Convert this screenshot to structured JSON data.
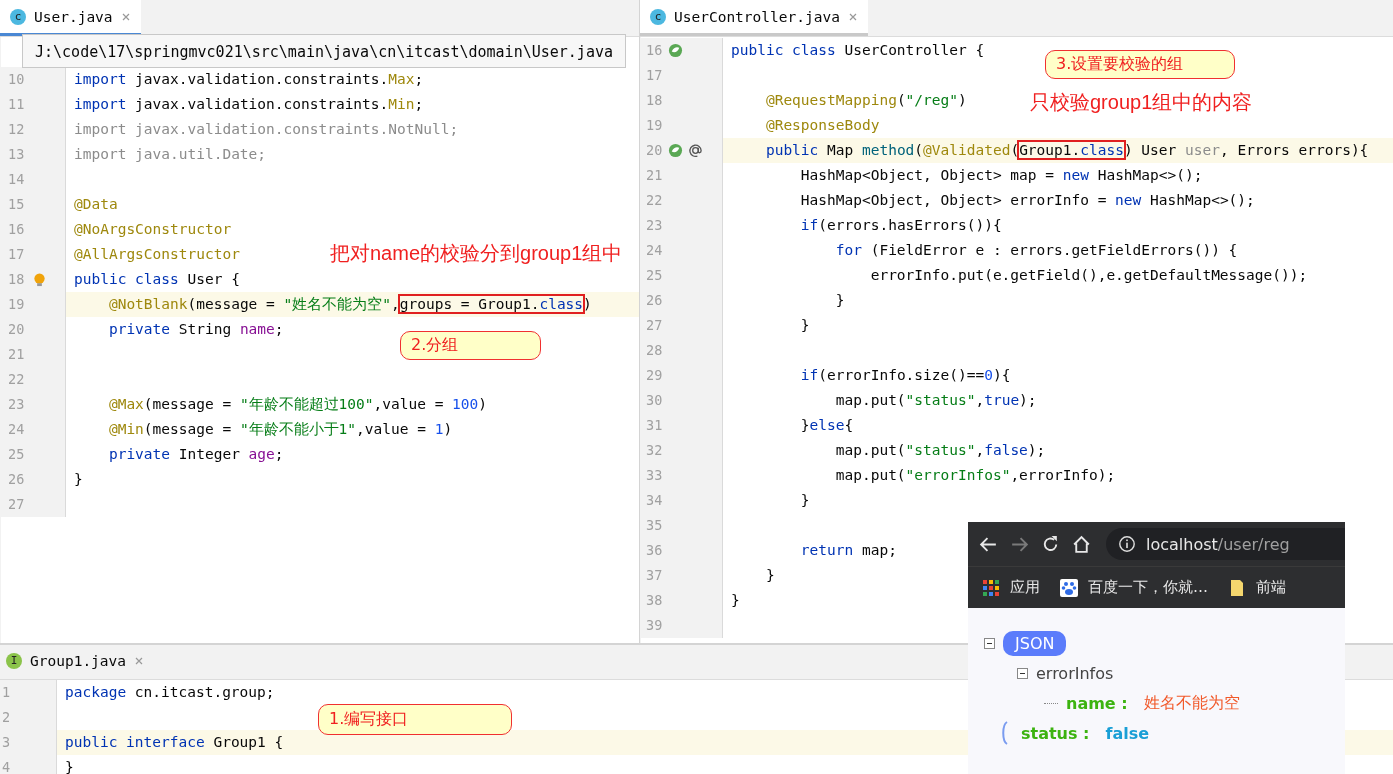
{
  "editors": [
    {
      "tabs": [
        {
          "label": "User.java",
          "badge": "c",
          "kind": "class",
          "selected": true
        }
      ],
      "tooltip": "J:\\code\\17\\springmvc021\\src\\main\\java\\cn\\itcast\\domain\\User.java",
      "lines": [
        {
          "n": "10",
          "current": false,
          "t": [
            {
              "kind": "kw",
              "text": "import"
            },
            {
              "kind": "p",
              "text": " javax.validation.constraints."
            },
            {
              "kind": "ann",
              "text": "Max"
            },
            {
              "kind": "p",
              "text": ";"
            }
          ]
        },
        {
          "n": "11",
          "current": false,
          "t": [
            {
              "kind": "kw",
              "text": "import"
            },
            {
              "kind": "p",
              "text": " javax.validation.constraints."
            },
            {
              "kind": "ann",
              "text": "Min"
            },
            {
              "kind": "p",
              "text": ";"
            }
          ]
        },
        {
          "n": "12",
          "current": false,
          "t": [
            {
              "kind": "dim",
              "text": "import javax.validation.constraints.NotNull;"
            }
          ]
        },
        {
          "n": "13",
          "current": false,
          "t": [
            {
              "kind": "dim",
              "text": "import java.util.Date;"
            }
          ]
        },
        {
          "n": "14",
          "current": false
        },
        {
          "n": "15",
          "current": false,
          "t": [
            {
              "kind": "ann",
              "text": "@Data"
            }
          ]
        },
        {
          "n": "16",
          "current": false,
          "t": [
            {
              "kind": "ann",
              "text": "@NoArgsConstructor"
            }
          ]
        },
        {
          "n": "17",
          "current": false,
          "t": [
            {
              "kind": "ann",
              "text": "@AllArgsConstructor"
            }
          ]
        },
        {
          "n": "18",
          "current": false,
          "gutter": [
            {
              "kind": "bulb"
            }
          ],
          "t": [
            {
              "kind": "kw",
              "text": "public class"
            },
            {
              "kind": "p",
              "text": " User {"
            }
          ]
        },
        {
          "n": "19",
          "current": true,
          "t": [
            {
              "kind": "ann",
              "text": "    @NotBlank"
            },
            {
              "kind": "p",
              "text": "(message = "
            },
            {
              "kind": "str",
              "text": "\"姓名不能为空\""
            },
            {
              "kind": "p",
              "text": ","
            },
            {
              "kind": "box",
              "parts": [
                {
                  "kind": "p",
                  "text": "groups = Group1."
                },
                {
                  "kind": "kw",
                  "text": "class"
                }
              ]
            },
            {
              "kind": "p",
              "text": ")"
            }
          ]
        },
        {
          "n": "20",
          "current": false,
          "t": [
            {
              "kind": "kw",
              "text": "    private"
            },
            {
              "kind": "p",
              "text": " String "
            },
            {
              "kind": "field",
              "text": "name"
            },
            {
              "kind": "p",
              "text": ";"
            }
          ]
        },
        {
          "n": "21",
          "current": false
        },
        {
          "n": "22",
          "current": false
        },
        {
          "n": "23",
          "current": false,
          "t": [
            {
              "kind": "ann",
              "text": "    @Max"
            },
            {
              "kind": "p",
              "text": "(message = "
            },
            {
              "kind": "str",
              "text": "\"年龄不能超过100\""
            },
            {
              "kind": "p",
              "text": ",value = "
            },
            {
              "kind": "num",
              "text": "100"
            },
            {
              "kind": "p",
              "text": ")"
            }
          ]
        },
        {
          "n": "24",
          "current": false,
          "t": [
            {
              "kind": "ann",
              "text": "    @Min"
            },
            {
              "kind": "p",
              "text": "(message = "
            },
            {
              "kind": "str",
              "text": "\"年龄不能小于1\""
            },
            {
              "kind": "p",
              "text": ",value = "
            },
            {
              "kind": "num",
              "text": "1"
            },
            {
              "kind": "p",
              "text": ")"
            }
          ]
        },
        {
          "n": "25",
          "current": false,
          "t": [
            {
              "kind": "kw",
              "text": "    private"
            },
            {
              "kind": "p",
              "text": " Integer "
            },
            {
              "kind": "field",
              "text": "age"
            },
            {
              "kind": "p",
              "text": ";"
            }
          ]
        },
        {
          "n": "26",
          "current": false,
          "t": [
            {
              "kind": "p",
              "text": "}"
            }
          ]
        },
        {
          "n": "27",
          "current": false
        }
      ],
      "notes": [
        {
          "kind": "label",
          "text": "把对name的校验分到group1组中"
        },
        {
          "kind": "bubble",
          "text": "2.分组"
        }
      ]
    },
    {
      "tabs": [
        {
          "label": "UserController.java",
          "badge": "c",
          "kind": "class",
          "selected": false
        }
      ],
      "lines": [
        {
          "n": "16",
          "current": false,
          "gutter": [
            {
              "kind": "bean"
            }
          ],
          "t": [
            {
              "kind": "kw",
              "text": "public class"
            },
            {
              "kind": "p",
              "text": " UserController {"
            }
          ]
        },
        {
          "n": "17",
          "current": false
        },
        {
          "n": "18",
          "current": false,
          "t": [
            {
              "kind": "ann",
              "text": "    @RequestMapping"
            },
            {
              "kind": "p",
              "text": "("
            },
            {
              "kind": "str",
              "text": "\"/reg\""
            },
            {
              "kind": "p",
              "text": ")"
            }
          ]
        },
        {
          "n": "19",
          "current": false,
          "t": [
            {
              "kind": "ann",
              "text": "    @ResponseBody"
            }
          ]
        },
        {
          "n": "20",
          "current": true,
          "gutter": [
            {
              "kind": "bean"
            },
            {
              "kind": "at"
            }
          ],
          "t": [
            {
              "kind": "kw",
              "text": "    public"
            },
            {
              "kind": "p",
              "text": " Map "
            },
            {
              "kind": "fn",
              "text": "method"
            },
            {
              "kind": "p",
              "text": "("
            },
            {
              "kind": "ann",
              "text": "@Validated"
            },
            {
              "kind": "p",
              "text": "("
            },
            {
              "kind": "box",
              "parts": [
                {
                  "kind": "p",
                  "text": "Group1."
                },
                {
                  "kind": "kw",
                  "text": "class"
                }
              ]
            },
            {
              "kind": "p",
              "text": ") User "
            },
            {
              "kind": "dim",
              "text": "user"
            },
            {
              "kind": "p",
              "text": ", Errors errors){"
            }
          ]
        },
        {
          "n": "21",
          "current": false,
          "t": [
            {
              "kind": "p",
              "text": "        HashMap<Object, Object> map = "
            },
            {
              "kind": "kw",
              "text": "new"
            },
            {
              "kind": "p",
              "text": " HashMap<>();"
            }
          ]
        },
        {
          "n": "22",
          "current": false,
          "t": [
            {
              "kind": "p",
              "text": "        HashMap<Object, Object> errorInfo = "
            },
            {
              "kind": "kw",
              "text": "new"
            },
            {
              "kind": "p",
              "text": " HashMap<>();"
            }
          ]
        },
        {
          "n": "23",
          "current": false,
          "t": [
            {
              "kind": "kw",
              "text": "        if"
            },
            {
              "kind": "p",
              "text": "(errors.hasErrors()){"
            }
          ]
        },
        {
          "n": "24",
          "current": false,
          "t": [
            {
              "kind": "kw",
              "text": "            for"
            },
            {
              "kind": "p",
              "text": " (FieldError e : errors.getFieldErrors()) {"
            }
          ]
        },
        {
          "n": "25",
          "current": false,
          "t": [
            {
              "kind": "p",
              "text": "                errorInfo.put(e.getField(),e.getDefaultMessage());"
            }
          ]
        },
        {
          "n": "26",
          "current": false,
          "t": [
            {
              "kind": "p",
              "text": "            }"
            }
          ]
        },
        {
          "n": "27",
          "current": false,
          "t": [
            {
              "kind": "p",
              "text": "        }"
            }
          ]
        },
        {
          "n": "28",
          "current": false
        },
        {
          "n": "29",
          "current": false,
          "t": [
            {
              "kind": "kw",
              "text": "        if"
            },
            {
              "kind": "p",
              "text": "(errorInfo.size()=="
            },
            {
              "kind": "num",
              "text": "0"
            },
            {
              "kind": "p",
              "text": "){"
            }
          ]
        },
        {
          "n": "30",
          "current": false,
          "t": [
            {
              "kind": "p",
              "text": "            map.put("
            },
            {
              "kind": "str",
              "text": "\"status\""
            },
            {
              "kind": "p",
              "text": ","
            },
            {
              "kind": "kw",
              "text": "true"
            },
            {
              "kind": "p",
              "text": ");"
            }
          ]
        },
        {
          "n": "31",
          "current": false,
          "t": [
            {
              "kind": "p",
              "text": "        }"
            },
            {
              "kind": "kw",
              "text": "else"
            },
            {
              "kind": "p",
              "text": "{"
            }
          ]
        },
        {
          "n": "32",
          "current": false,
          "t": [
            {
              "kind": "p",
              "text": "            map.put("
            },
            {
              "kind": "str",
              "text": "\"status\""
            },
            {
              "kind": "p",
              "text": ","
            },
            {
              "kind": "kw",
              "text": "false"
            },
            {
              "kind": "p",
              "text": ");"
            }
          ]
        },
        {
          "n": "33",
          "current": false,
          "t": [
            {
              "kind": "p",
              "text": "            map.put("
            },
            {
              "kind": "str",
              "text": "\"errorInfos\""
            },
            {
              "kind": "p",
              "text": ",errorInfo);"
            }
          ]
        },
        {
          "n": "34",
          "current": false,
          "t": [
            {
              "kind": "p",
              "text": "        }"
            }
          ]
        },
        {
          "n": "35",
          "current": false
        },
        {
          "n": "36",
          "current": false,
          "t": [
            {
              "kind": "kw",
              "text": "        return"
            },
            {
              "kind": "p",
              "text": " map;"
            }
          ]
        },
        {
          "n": "37",
          "current": false,
          "t": [
            {
              "kind": "p",
              "text": "    }"
            }
          ]
        },
        {
          "n": "38",
          "current": false,
          "t": [
            {
              "kind": "p",
              "text": "}"
            }
          ]
        },
        {
          "n": "39",
          "current": false
        }
      ],
      "notes": [
        {
          "kind": "bubble",
          "text": "3.设置要校验的组"
        },
        {
          "kind": "label",
          "text": "只校验group1组中的内容"
        }
      ]
    },
    {
      "tabs": [
        {
          "label": "Group1.java",
          "badge": "I",
          "kind": "interface",
          "selected": false
        }
      ],
      "lines": [
        {
          "n": "1",
          "current": false,
          "t": [
            {
              "kind": "kw",
              "text": "package"
            },
            {
              "kind": "p",
              "text": " cn.itcast.group;"
            }
          ]
        },
        {
          "n": "2",
          "current": false
        },
        {
          "n": "3",
          "current": true,
          "t": [
            {
              "kind": "kw",
              "text": "public interface"
            },
            {
              "kind": "p",
              "text": " Group1 {"
            }
          ]
        },
        {
          "n": "4",
          "current": false,
          "t": [
            {
              "kind": "p",
              "text": "}"
            }
          ]
        }
      ],
      "notes": [
        {
          "kind": "bubble",
          "text": "1.编写接口"
        }
      ]
    }
  ],
  "browser": {
    "url_host": "localhost",
    "url_path": "/user/reg",
    "nav": [
      {
        "kind": "back",
        "disabled": false
      },
      {
        "kind": "forward",
        "disabled": true
      },
      {
        "kind": "reload",
        "disabled": false
      },
      {
        "kind": "home",
        "disabled": false
      }
    ],
    "bookmarks": [
      {
        "kind": "apps",
        "label": "应用"
      },
      {
        "kind": "paw",
        "label": "百度一下，你就…"
      },
      {
        "kind": "folder",
        "label": "前端"
      }
    ],
    "json": {
      "badge": "JSON",
      "expanded": true,
      "nodes": [
        {
          "label": "errorInfos",
          "expanded": true,
          "children": [
            {
              "label": "name :",
              "value": "姓名不能为空",
              "kind": "string"
            }
          ]
        },
        {
          "label": "status :",
          "value": "false",
          "kind": "boolean"
        }
      ]
    }
  }
}
